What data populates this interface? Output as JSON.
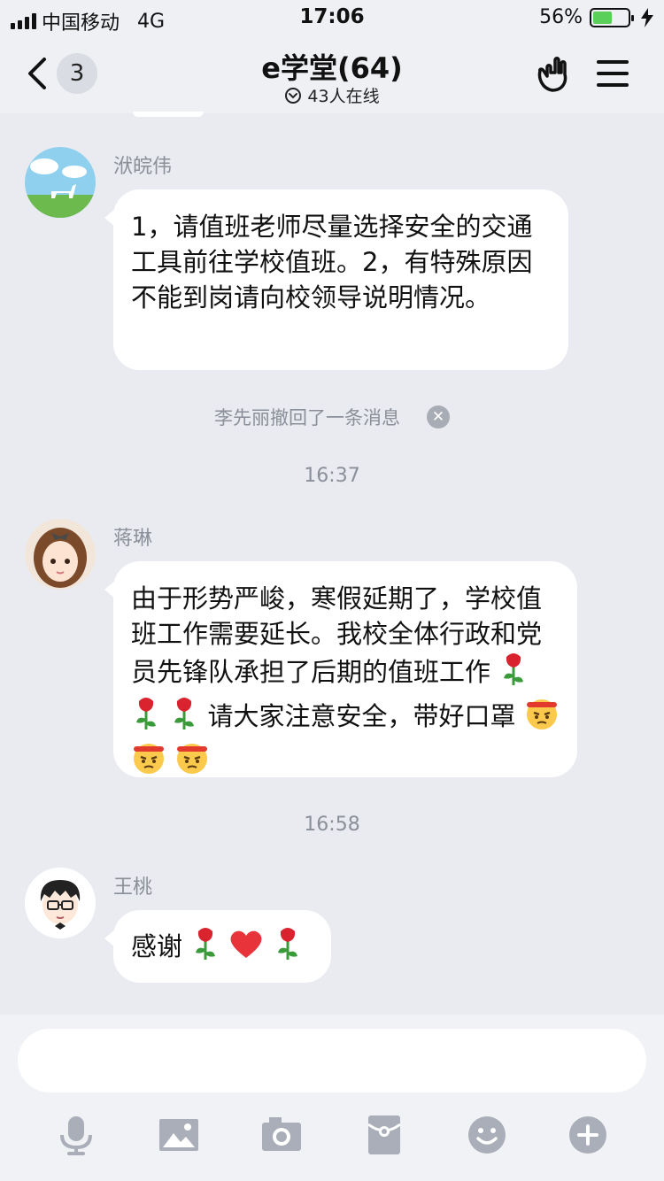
{
  "status_bar": {
    "carrier": "中国移动",
    "network": "4G",
    "time": "17:06",
    "battery_percent": "56%",
    "battery_level": 0.56
  },
  "header": {
    "back_count": "3",
    "title": "e学堂(64)",
    "online": "43人在线"
  },
  "messages": [
    {
      "sender": "洑皖伟",
      "text": "1，请值班老师尽量选择安全的交通工具前往学校值班。2，有特殊原因不能到岗请向校领导说明情况。"
    },
    {
      "sender": "蒋琳",
      "text_1": "由于形势严峻，寒假延期了，学校值班工作需要延长。我校全体行政和党员先锋队承担了后期的值班工作",
      "text_2": "请大家注意安全，带好口罩"
    },
    {
      "sender": "王桃",
      "text": "感谢"
    }
  ],
  "system": {
    "recall_notice": "李先丽撤回了一条消息",
    "time_1": "16:37",
    "time_2": "16:58"
  },
  "input": {
    "value": "",
    "tools": [
      "mic-icon",
      "image-icon",
      "camera-icon",
      "red-packet-icon",
      "emoji-icon",
      "plus-icon"
    ]
  },
  "colors": {
    "background": "#e9ebf0",
    "bubble": "#ffffff",
    "battery_fill": "#5ad05a",
    "rose": "#d9232e",
    "heart": "#e8333b"
  }
}
